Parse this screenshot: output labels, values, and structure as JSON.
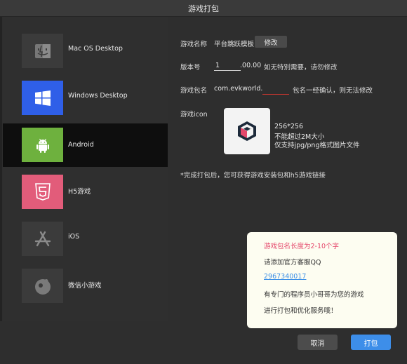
{
  "window": {
    "title": "游戏打包"
  },
  "sidebar": {
    "items": [
      {
        "label": "Mac OS Desktop",
        "icon": "mac-finder-icon",
        "active": false
      },
      {
        "label": "Windows Desktop",
        "icon": "windows-icon",
        "active": false
      },
      {
        "label": "Android",
        "icon": "android-icon",
        "active": true
      },
      {
        "label": "H5游戏",
        "icon": "html5-icon",
        "active": false
      },
      {
        "label": "iOS",
        "icon": "app-store-icon",
        "active": false
      },
      {
        "label": "微信小游戏",
        "icon": "wechat-minigame-icon",
        "active": false
      }
    ]
  },
  "form": {
    "game_name_label": "游戏名称",
    "game_name_value": "平台跳跃模板",
    "modify_button": "修改",
    "version_label": "版本号",
    "version_value": "1",
    "version_suffix": ".00.00",
    "version_hint": "如无特別需要，请勿修改",
    "package_label": "游戏包名",
    "package_prefix": "com.evkworld.",
    "package_value": "",
    "package_hint": "包名一经确认，则无法修改",
    "icon_label": "游戏icon",
    "icon_size": "256*256",
    "icon_limit": "不能超过2M大小",
    "icon_format": "仅支持jpg/png格式图片文件",
    "complete_note": "*完成打包后，您可获得游戏安装包和h5游戏链接"
  },
  "toast": {
    "error": "游戏包名长度为2-10个字",
    "line1": "请添加官方客服QQ",
    "qq": "2967340017",
    "line2": "有专门的程序员小哥哥为您的游戏",
    "line3": "进行打包和优化服务哦！"
  },
  "footer": {
    "cancel": "取消",
    "pack": "打包"
  },
  "colors": {
    "accent": "#3d8ee9",
    "error": "#e5476b",
    "windows_tile": "#2f5fe8",
    "android_tile": "#6eb13e",
    "h5_tile": "#e25c7a"
  }
}
